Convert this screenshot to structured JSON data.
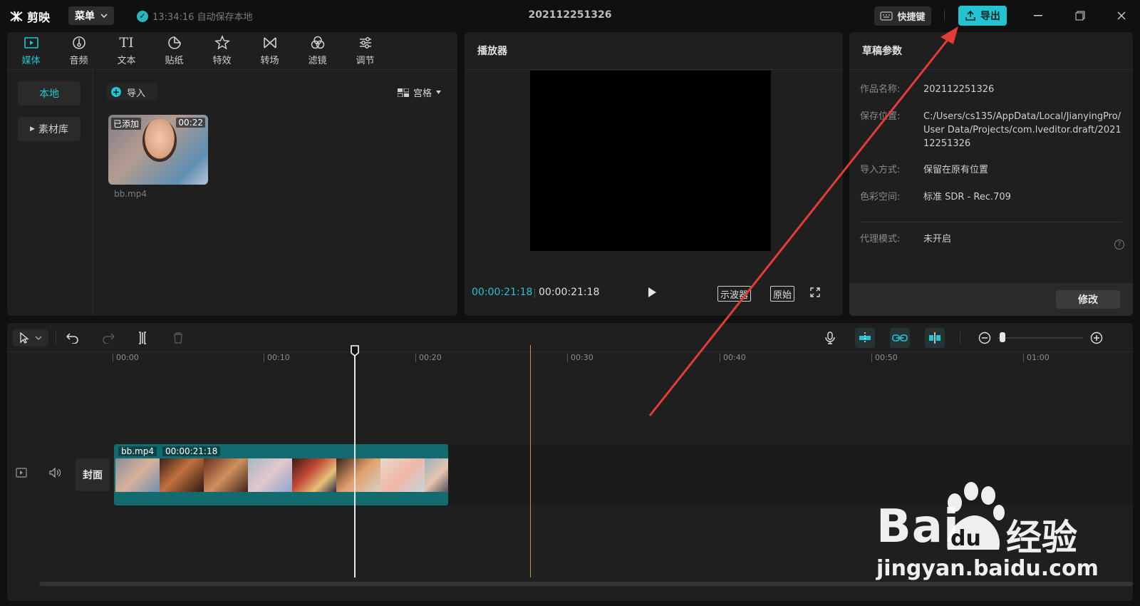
{
  "app": {
    "logo_text": "剪映",
    "menu_label": "菜单",
    "autosave_text": "13:34:16 自动保存本地",
    "project_title": "202112251326",
    "shortcut_label": "快捷键",
    "export_label": "导出",
    "accent_color": "#22c4d1"
  },
  "media": {
    "tabs": [
      {
        "label": "媒体",
        "icon": "media-icon"
      },
      {
        "label": "音频",
        "icon": "audio-icon"
      },
      {
        "label": "文本",
        "icon": "text-icon",
        "glyph": "TI"
      },
      {
        "label": "贴纸",
        "icon": "sticker-icon"
      },
      {
        "label": "特效",
        "icon": "effects-icon"
      },
      {
        "label": "转场",
        "icon": "transition-icon"
      },
      {
        "label": "滤镜",
        "icon": "filter-icon"
      },
      {
        "label": "调节",
        "icon": "adjust-icon"
      }
    ],
    "side_items": [
      {
        "label": "本地"
      },
      {
        "label": "素材库"
      }
    ],
    "import_label": "导入",
    "grid_label": "宫格",
    "asset": {
      "added_badge": "已添加",
      "duration": "00:22",
      "name": "bb.mp4"
    }
  },
  "player": {
    "title": "播放器",
    "current_time": "00:00:21:18",
    "total_time": "00:00:21:18",
    "scope_label": "示波器",
    "ratio_label": "原始"
  },
  "params": {
    "title": "草稿参数",
    "rows": [
      {
        "label": "作品名称:",
        "value": "202112251326"
      },
      {
        "label": "保存位置:",
        "value": "C:/Users/cs135/AppData/Local/JianyingPro/User Data/Projects/com.lveditor.draft/202112251326"
      },
      {
        "label": "导入方式:",
        "value": "保留在原有位置"
      },
      {
        "label": "色彩空间:",
        "value": "标准 SDR - Rec.709"
      },
      {
        "label": "代理模式:",
        "value": "未开启"
      }
    ],
    "modify_label": "修改"
  },
  "timeline": {
    "ruler": [
      "00:00",
      "00:10",
      "00:20",
      "00:30",
      "00:40",
      "00:50",
      "01:00"
    ],
    "clip_name": "bb.mp4",
    "clip_duration": "00:00:21:18",
    "cover_label": "封面"
  },
  "watermark": {
    "brand": "Bai",
    "brand_mid": "du",
    "brand_cn": "经验",
    "url": "jingyan.baidu.com"
  }
}
